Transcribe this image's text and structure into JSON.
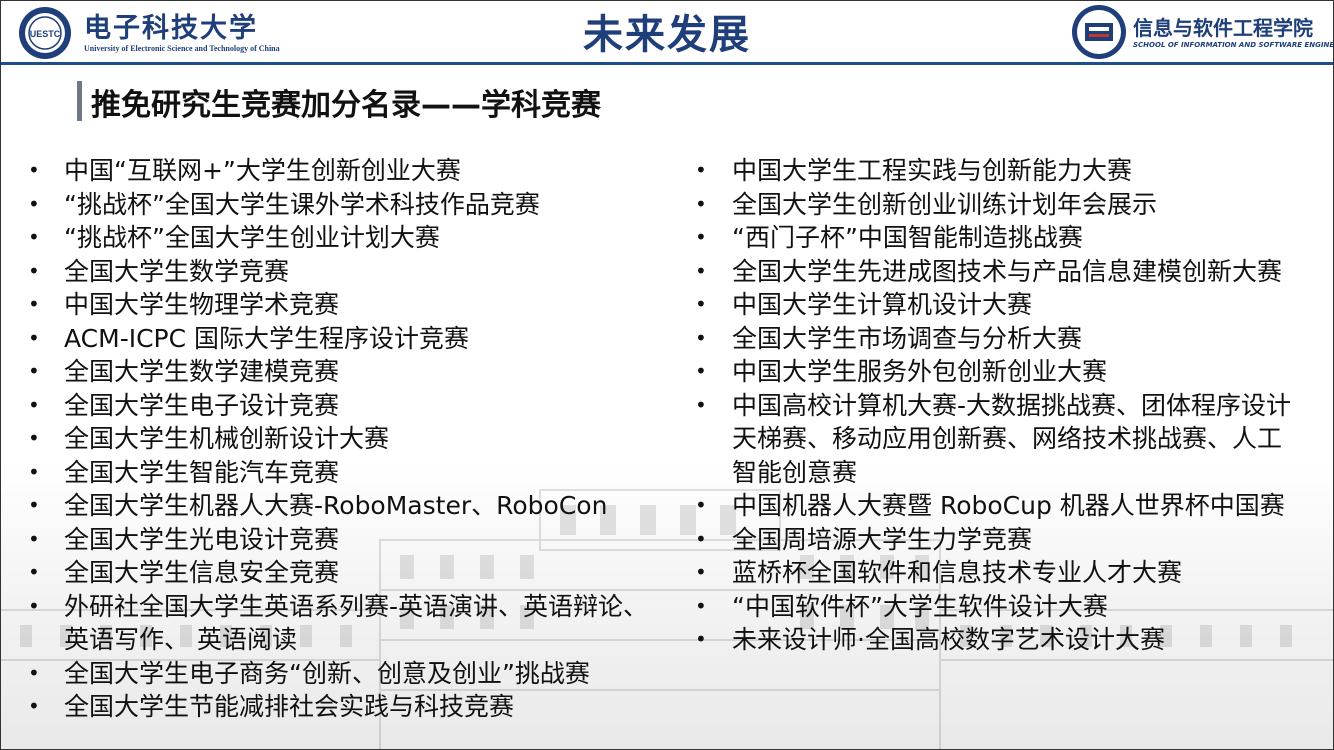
{
  "header": {
    "university_name": "电子科技大学",
    "university_english": "University of Electronic Science and Technology of China",
    "logo_left_text": "UESTC",
    "title": "未来发展",
    "school_name": "信息与软件工程学院",
    "school_english": "SCHOOL OF INFORMATION AND SOFTWARE ENGINEERING"
  },
  "section": {
    "heading": "推免研究生竞赛加分名录——学科竞赛"
  },
  "left_list": [
    "中国“互联网+”大学生创新创业大赛",
    "“挑战杯”全国大学生课外学术科技作品竞赛",
    "“挑战杯”全国大学生创业计划大赛",
    "全国大学生数学竞赛",
    "中国大学生物理学术竞赛",
    "ACM-ICPC 国际大学生程序设计竞赛",
    "全国大学生数学建模竞赛",
    "全国大学生电子设计竞赛",
    "全国大学生机械创新设计大赛",
    "全国大学生智能汽车竞赛",
    "全国大学生机器人大赛-RoboMaster、RoboCon",
    "全国大学生光电设计竞赛",
    "全国大学生信息安全竞赛",
    "外研社全国大学生英语系列赛-英语演讲、英语辩论、英语写作、 英语阅读",
    "全国大学生电子商务“创新、创意及创业”挑战赛",
    "全国大学生节能减排社会实践与科技竞赛"
  ],
  "right_list": [
    "中国大学生工程实践与创新能力大赛",
    "全国大学生创新创业训练计划年会展示",
    "“西门子杯”中国智能制造挑战赛",
    "全国大学生先进成图技术与产品信息建模创新大赛",
    "中国大学生计算机设计大赛",
    "全国大学生市场调查与分析大赛",
    "中国大学生服务外包创新创业大赛",
    "中国高校计算机大赛-大数据挑战赛、团体程序设计天梯赛、移动应用创新赛、网络技术挑战赛、人工智能创意赛",
    "中国机器人大赛暨 RoboCup 机器人世界杯中国赛",
    "全国周培源大学生力学竞赛",
    "蓝桥杯全国软件和信息技术专业人才大赛",
    "“中国软件杯”大学生软件设计大赛",
    "未来设计师·全国高校数字艺术设计大赛"
  ],
  "colors": {
    "brand_blue": "#1f3f7a",
    "accent_bar": "#6e7785"
  }
}
